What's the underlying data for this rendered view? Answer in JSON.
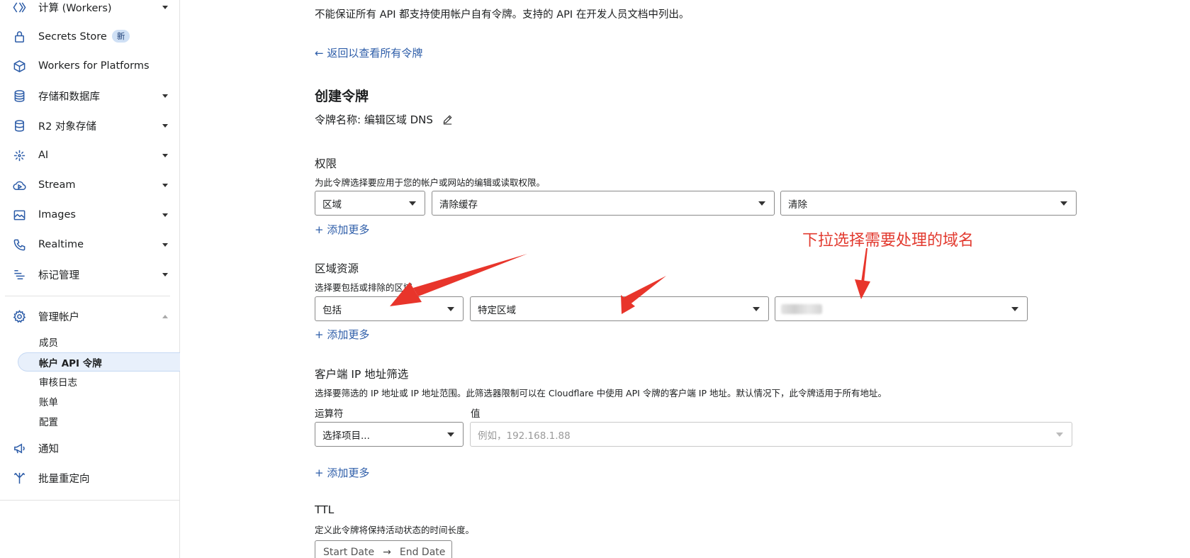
{
  "sidebar": {
    "items": [
      {
        "label": "计算 (Workers)",
        "icon": "workers-icon",
        "caret": "down"
      },
      {
        "label": "Secrets Store",
        "icon": "lock-icon",
        "badge": "新"
      },
      {
        "label": "Workers for Platforms",
        "icon": "cube-icon"
      },
      {
        "label": "存储和数据库",
        "icon": "database-icon",
        "caret": "down"
      },
      {
        "label": "R2 对象存储",
        "icon": "storage-icon",
        "caret": "down"
      },
      {
        "label": "AI",
        "icon": "sparkle-icon",
        "caret": "down"
      },
      {
        "label": "Stream",
        "icon": "cloud-play-icon",
        "caret": "down"
      },
      {
        "label": "Images",
        "icon": "image-icon",
        "caret": "down"
      },
      {
        "label": "Realtime",
        "icon": "phone-icon",
        "caret": "down"
      },
      {
        "label": "标记管理",
        "icon": "tag-manage-icon",
        "caret": "down"
      }
    ],
    "account": {
      "label": "管理帐户",
      "icon": "gear-icon",
      "sub_items": [
        "成员",
        "帐户 API 令牌",
        "审核日志",
        "账单",
        "配置"
      ],
      "active_index": 1
    },
    "bottom_items": [
      {
        "label": "通知",
        "icon": "megaphone-icon"
      },
      {
        "label": "批量重定向",
        "icon": "redirect-icon"
      }
    ]
  },
  "main": {
    "intro": "不能保证所有 API 都支持使用帐户自有令牌。支持的 API 在开发人员文档中列出。",
    "back_link": "← 返回以查看所有令牌",
    "title": "创建令牌",
    "token_name": "令牌名称: 编辑区域 DNS",
    "permissions": {
      "title": "权限",
      "desc": "为此令牌选择要应用于您的帐户或网站的编辑或读取权限。",
      "selects": [
        "区域",
        "清除缓存",
        "清除"
      ],
      "add_more": "+ 添加更多"
    },
    "zone_resources": {
      "title": "区域资源",
      "desc": "选择要包括或排除的区域。",
      "selects": [
        "包括",
        "特定区域",
        ""
      ],
      "add_more": "+ 添加更多"
    },
    "client_ip": {
      "title": "客户端 IP 地址筛选",
      "desc": "选择要筛选的 IP 地址或 IP 地址范围。此筛选器限制可以在 Cloudflare 中使用 API 令牌的客户端 IP 地址。默认情况下，此令牌适用于所有地址。",
      "operator_label": "运算符",
      "value_label": "值",
      "operator_value": "选择项目...",
      "value_placeholder": "例如，192.168.1.88",
      "add_more": "+ 添加更多"
    },
    "ttl": {
      "title": "TTL",
      "desc": "定义此令牌将保持活动状态的时间长度。",
      "start": "Start Date",
      "arrow": "→",
      "end": "End Date"
    }
  },
  "annotation": {
    "text": "下拉选择需要处理的域名",
    "color": "#e23a2f"
  },
  "colors": {
    "link": "#2c5ca8",
    "icon": "#2c5ca8",
    "active_bg": "#e8f0fb"
  }
}
